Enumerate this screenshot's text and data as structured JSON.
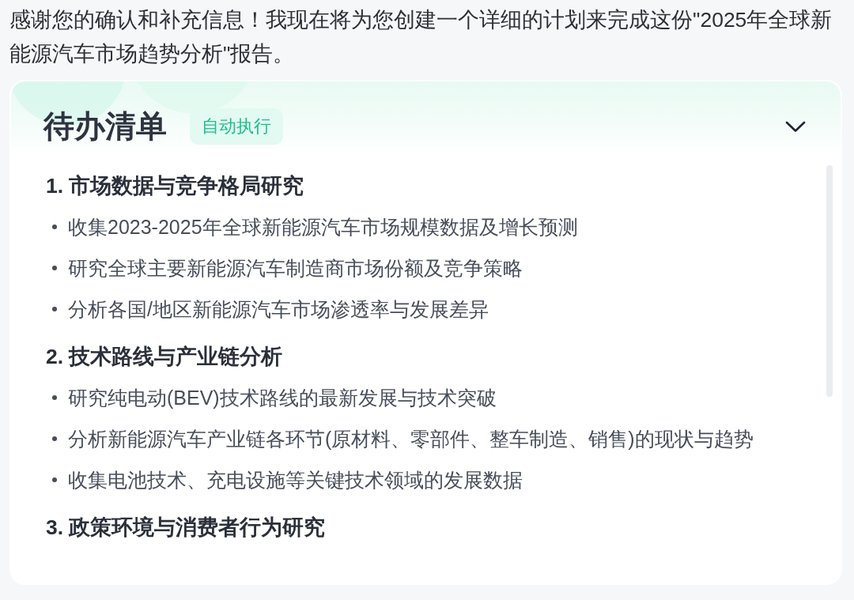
{
  "intro": "感谢您的确认和补充信息！我现在将为您创建一个详细的计划来完成这份\"2025年全球新能源汽车市场趋势分析\"报告。",
  "todo_card": {
    "title": "待办清单",
    "badge": "自动执行",
    "expanded": true,
    "sections": [
      {
        "heading": "1. 市场数据与竞争格局研究",
        "items": [
          "收集2023-2025年全球新能源汽车市场规模数据及增长预测",
          "研究全球主要新能源汽车制造商市场份额及竞争策略",
          "分析各国/地区新能源汽车市场渗透率与发展差异"
        ]
      },
      {
        "heading": "2. 技术路线与产业链分析",
        "items": [
          "研究纯电动(BEV)技术路线的最新发展与技术突破",
          "分析新能源汽车产业链各环节(原材料、零部件、整车制造、销售)的现状与趋势",
          "收集电池技术、充电设施等关键技术领域的发展数据"
        ]
      },
      {
        "heading": "3. 政策环境与消费者行为研究"
      }
    ]
  }
}
